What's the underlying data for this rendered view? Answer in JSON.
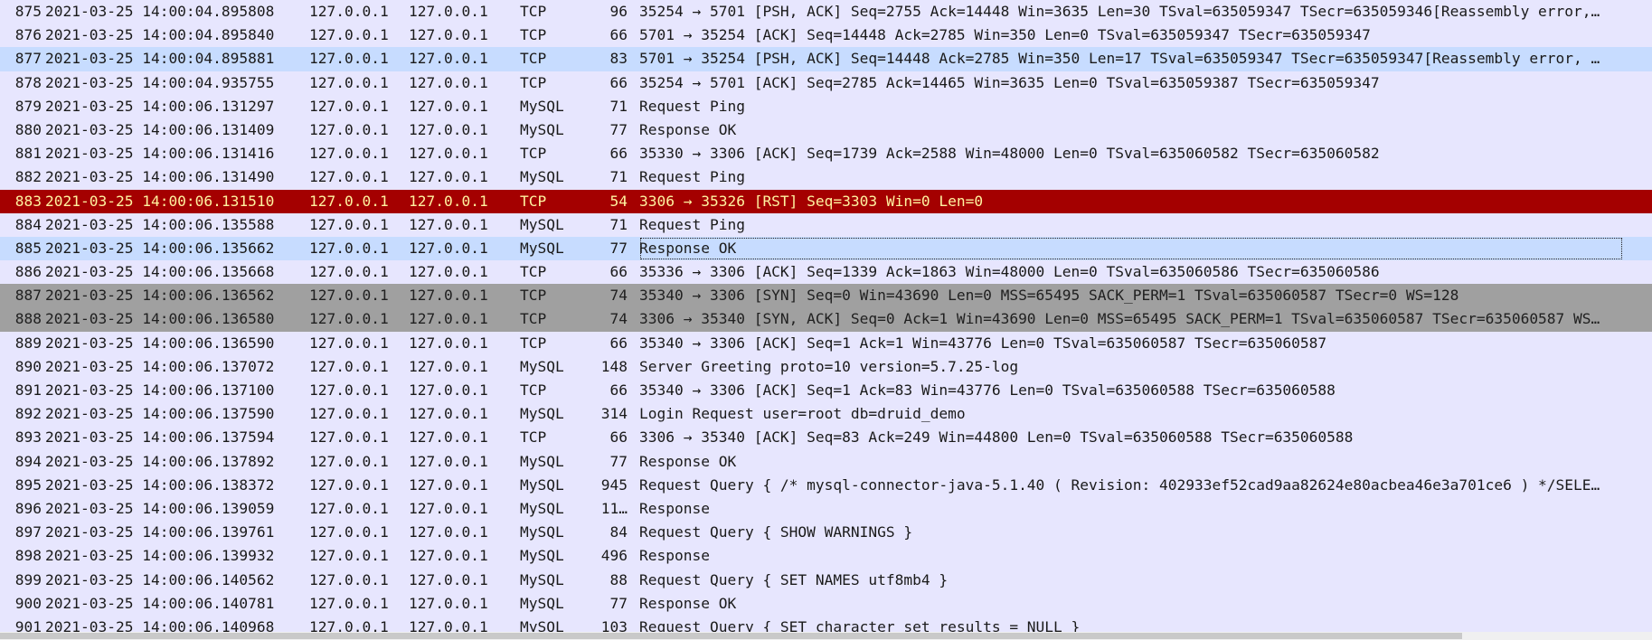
{
  "packets": [
    {
      "no": "875",
      "time": "2021-03-25 14:00:04.895808",
      "src": "127.0.0.1",
      "dst": "127.0.0.1",
      "proto": "TCP",
      "len": "96",
      "info": "35254 → 5701 [PSH, ACK] Seq=2755 Ack=14448 Win=3635 Len=30 TSval=635059347 TSecr=635059346[Reassembly error,…",
      "style": "light"
    },
    {
      "no": "876",
      "time": "2021-03-25 14:00:04.895840",
      "src": "127.0.0.1",
      "dst": "127.0.0.1",
      "proto": "TCP",
      "len": "66",
      "info": "5701 → 35254 [ACK] Seq=14448 Ack=2785 Win=350 Len=0 TSval=635059347 TSecr=635059347",
      "style": "light"
    },
    {
      "no": "877",
      "time": "2021-03-25 14:00:04.895881",
      "src": "127.0.0.1",
      "dst": "127.0.0.1",
      "proto": "TCP",
      "len": "83",
      "info": "5701 → 35254 [PSH, ACK] Seq=14448 Ack=2785 Win=350 Len=17 TSval=635059347 TSecr=635059347[Reassembly error, …",
      "style": "hl-blue"
    },
    {
      "no": "878",
      "time": "2021-03-25 14:00:04.935755",
      "src": "127.0.0.1",
      "dst": "127.0.0.1",
      "proto": "TCP",
      "len": "66",
      "info": "35254 → 5701 [ACK] Seq=2785 Ack=14465 Win=3635 Len=0 TSval=635059387 TSecr=635059347",
      "style": "light"
    },
    {
      "no": "879",
      "time": "2021-03-25 14:00:06.131297",
      "src": "127.0.0.1",
      "dst": "127.0.0.1",
      "proto": "MySQL",
      "len": "71",
      "info": "Request Ping",
      "style": "light"
    },
    {
      "no": "880",
      "time": "2021-03-25 14:00:06.131409",
      "src": "127.0.0.1",
      "dst": "127.0.0.1",
      "proto": "MySQL",
      "len": "77",
      "info": "Response OK",
      "style": "light"
    },
    {
      "no": "881",
      "time": "2021-03-25 14:00:06.131416",
      "src": "127.0.0.1",
      "dst": "127.0.0.1",
      "proto": "TCP",
      "len": "66",
      "info": "35330 → 3306 [ACK] Seq=1739 Ack=2588 Win=48000 Len=0 TSval=635060582 TSecr=635060582",
      "style": "light"
    },
    {
      "no": "882",
      "time": "2021-03-25 14:00:06.131490",
      "src": "127.0.0.1",
      "dst": "127.0.0.1",
      "proto": "MySQL",
      "len": "71",
      "info": "Request Ping",
      "style": "light"
    },
    {
      "no": "883",
      "time": "2021-03-25 14:00:06.131510",
      "src": "127.0.0.1",
      "dst": "127.0.0.1",
      "proto": "TCP",
      "len": "54",
      "info": "3306 → 35326 [RST] Seq=3303 Win=0 Len=0",
      "style": "hl-red"
    },
    {
      "no": "884",
      "time": "2021-03-25 14:00:06.135588",
      "src": "127.0.0.1",
      "dst": "127.0.0.1",
      "proto": "MySQL",
      "len": "71",
      "info": "Request Ping",
      "style": "light"
    },
    {
      "no": "885",
      "time": "2021-03-25 14:00:06.135662",
      "src": "127.0.0.1",
      "dst": "127.0.0.1",
      "proto": "MySQL",
      "len": "77",
      "info": "Response OK",
      "style": "hl-blue selected"
    },
    {
      "no": "886",
      "time": "2021-03-25 14:00:06.135668",
      "src": "127.0.0.1",
      "dst": "127.0.0.1",
      "proto": "TCP",
      "len": "66",
      "info": "35336 → 3306 [ACK] Seq=1339 Ack=1863 Win=48000 Len=0 TSval=635060586 TSecr=635060586",
      "style": "light"
    },
    {
      "no": "887",
      "time": "2021-03-25 14:00:06.136562",
      "src": "127.0.0.1",
      "dst": "127.0.0.1",
      "proto": "TCP",
      "len": "74",
      "info": "35340 → 3306 [SYN] Seq=0 Win=43690 Len=0 MSS=65495 SACK_PERM=1 TSval=635060587 TSecr=0 WS=128",
      "style": "gray"
    },
    {
      "no": "888",
      "time": "2021-03-25 14:00:06.136580",
      "src": "127.0.0.1",
      "dst": "127.0.0.1",
      "proto": "TCP",
      "len": "74",
      "info": "3306 → 35340 [SYN, ACK] Seq=0 Ack=1 Win=43690 Len=0 MSS=65495 SACK_PERM=1 TSval=635060587 TSecr=635060587 WS…",
      "style": "gray"
    },
    {
      "no": "889",
      "time": "2021-03-25 14:00:06.136590",
      "src": "127.0.0.1",
      "dst": "127.0.0.1",
      "proto": "TCP",
      "len": "66",
      "info": "35340 → 3306 [ACK] Seq=1 Ack=1 Win=43776 Len=0 TSval=635060587 TSecr=635060587",
      "style": "light"
    },
    {
      "no": "890",
      "time": "2021-03-25 14:00:06.137072",
      "src": "127.0.0.1",
      "dst": "127.0.0.1",
      "proto": "MySQL",
      "len": "148",
      "info": "Server Greeting proto=10 version=5.7.25-log",
      "style": "light"
    },
    {
      "no": "891",
      "time": "2021-03-25 14:00:06.137100",
      "src": "127.0.0.1",
      "dst": "127.0.0.1",
      "proto": "TCP",
      "len": "66",
      "info": "35340 → 3306 [ACK] Seq=1 Ack=83 Win=43776 Len=0 TSval=635060588 TSecr=635060588",
      "style": "light"
    },
    {
      "no": "892",
      "time": "2021-03-25 14:00:06.137590",
      "src": "127.0.0.1",
      "dst": "127.0.0.1",
      "proto": "MySQL",
      "len": "314",
      "info": "Login Request user=root db=druid_demo",
      "style": "light"
    },
    {
      "no": "893",
      "time": "2021-03-25 14:00:06.137594",
      "src": "127.0.0.1",
      "dst": "127.0.0.1",
      "proto": "TCP",
      "len": "66",
      "info": "3306 → 35340 [ACK] Seq=83 Ack=249 Win=44800 Len=0 TSval=635060588 TSecr=635060588",
      "style": "light"
    },
    {
      "no": "894",
      "time": "2021-03-25 14:00:06.137892",
      "src": "127.0.0.1",
      "dst": "127.0.0.1",
      "proto": "MySQL",
      "len": "77",
      "info": "Response OK",
      "style": "light"
    },
    {
      "no": "895",
      "time": "2021-03-25 14:00:06.138372",
      "src": "127.0.0.1",
      "dst": "127.0.0.1",
      "proto": "MySQL",
      "len": "945",
      "info": "Request Query { /* mysql-connector-java-5.1.40 ( Revision: 402933ef52cad9aa82624e80acbea46e3a701ce6 ) */SELE…",
      "style": "light"
    },
    {
      "no": "896",
      "time": "2021-03-25 14:00:06.139059",
      "src": "127.0.0.1",
      "dst": "127.0.0.1",
      "proto": "MySQL",
      "len": "11…",
      "info": "Response",
      "style": "light"
    },
    {
      "no": "897",
      "time": "2021-03-25 14:00:06.139761",
      "src": "127.0.0.1",
      "dst": "127.0.0.1",
      "proto": "MySQL",
      "len": "84",
      "info": "Request Query { SHOW WARNINGS }",
      "style": "light"
    },
    {
      "no": "898",
      "time": "2021-03-25 14:00:06.139932",
      "src": "127.0.0.1",
      "dst": "127.0.0.1",
      "proto": "MySQL",
      "len": "496",
      "info": "Response",
      "style": "light"
    },
    {
      "no": "899",
      "time": "2021-03-25 14:00:06.140562",
      "src": "127.0.0.1",
      "dst": "127.0.0.1",
      "proto": "MySQL",
      "len": "88",
      "info": "Request Query { SET NAMES utf8mb4 }",
      "style": "light"
    },
    {
      "no": "900",
      "time": "2021-03-25 14:00:06.140781",
      "src": "127.0.0.1",
      "dst": "127.0.0.1",
      "proto": "MySQL",
      "len": "77",
      "info": "Response OK",
      "style": "light"
    },
    {
      "no": "901",
      "time": "2021-03-25 14:00:06.140968",
      "src": "127.0.0.1",
      "dst": "127.0.0.1",
      "proto": "MySQL",
      "len": "103",
      "info": "Request Query { SET character set results = NULL }",
      "style": "light"
    }
  ],
  "colors": {
    "row_bg": "#e7e6fe",
    "highlight_blue": "#c7dcff",
    "rst_red": "#a40000",
    "rst_text": "#fff3a0",
    "syn_gray": "#a0a0a0"
  }
}
